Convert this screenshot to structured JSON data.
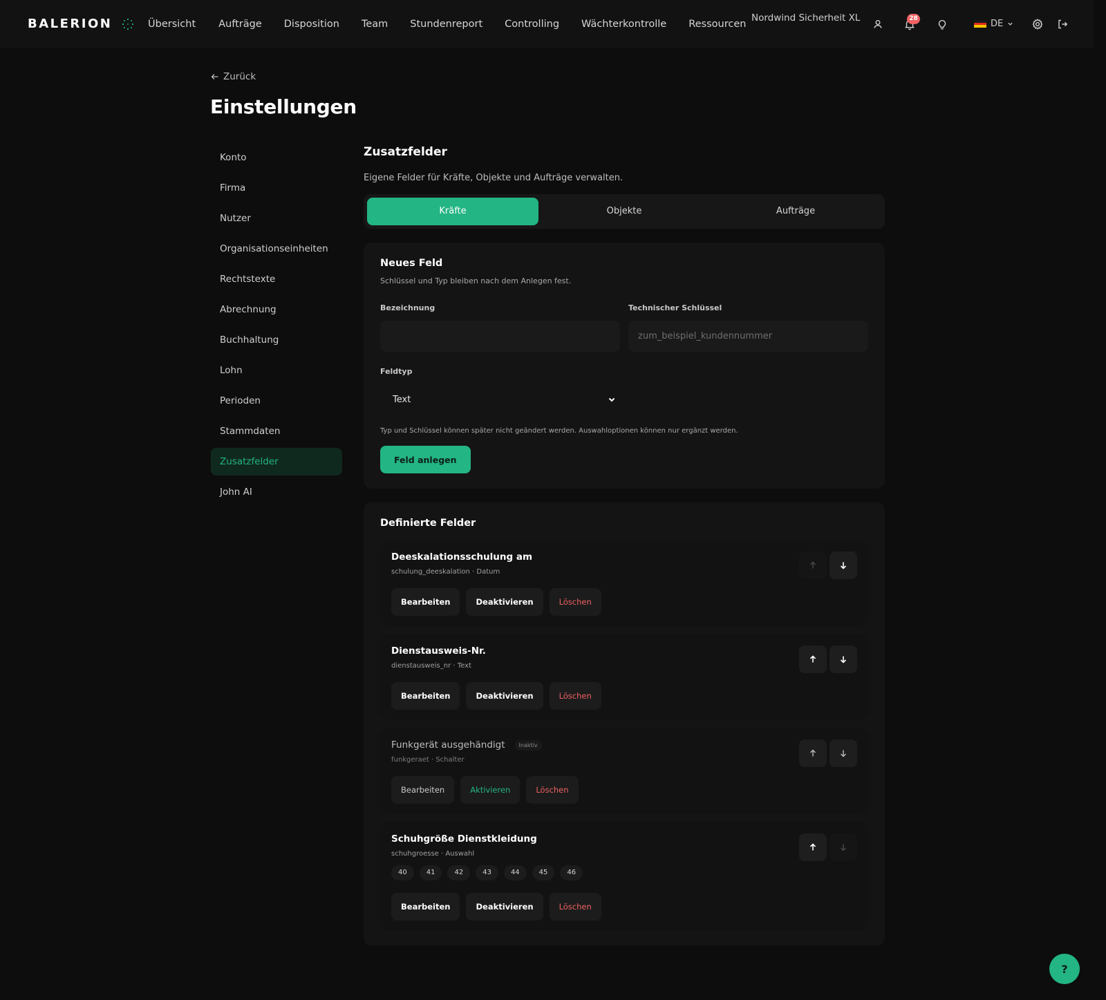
{
  "app": {
    "brand": "BALERION"
  },
  "nav": {
    "items": [
      "Übersicht",
      "Aufträge",
      "Disposition",
      "Team",
      "Stundenreport",
      "Controlling",
      "Wächterkontrolle",
      "Ressourcen"
    ]
  },
  "topbar": {
    "company": "Nordwind Sicherheit XL",
    "notifications_count": "28",
    "language": "DE"
  },
  "header": {
    "back_label": "Zurück",
    "title": "Einstellungen"
  },
  "sidebar": {
    "items": [
      {
        "label": "Konto"
      },
      {
        "label": "Firma"
      },
      {
        "label": "Nutzer"
      },
      {
        "label": "Organisationseinheiten"
      },
      {
        "label": "Rechtstexte"
      },
      {
        "label": "Abrechnung"
      },
      {
        "label": "Buchhaltung"
      },
      {
        "label": "Lohn"
      },
      {
        "label": "Perioden"
      },
      {
        "label": "Stammdaten"
      },
      {
        "label": "Zusatzfelder",
        "active": true
      },
      {
        "label": "John AI"
      }
    ]
  },
  "main": {
    "title": "Zusatzfelder",
    "subtitle": "Eigene Felder für Kräfte, Objekte und Aufträge verwalten.",
    "tabs": [
      {
        "label": "Kräfte",
        "active": true
      },
      {
        "label": "Objekte"
      },
      {
        "label": "Aufträge"
      }
    ]
  },
  "new_field": {
    "title": "Neues Feld",
    "subtitle": "Schlüssel und Typ bleiben nach dem Anlegen fest.",
    "label_label": "Bezeichnung",
    "label_value": "",
    "key_label": "Technischer Schlüssel",
    "key_placeholder": "zum_beispiel_kundennummer",
    "type_label": "Feldtyp",
    "type_value": "Text",
    "hint": "Typ und Schlüssel können später nicht geändert werden. Auswahloptionen können nur ergänzt werden.",
    "submit_label": "Feld anlegen"
  },
  "defined": {
    "title": "Definierte Felder",
    "actions": {
      "edit": "Bearbeiten",
      "deactivate": "Deaktivieren",
      "activate": "Aktivieren",
      "delete": "Löschen"
    },
    "inactive_tag": "Inaktiv",
    "fields": [
      {
        "name": "Deeskalationsschulung am",
        "meta": "schulung_deeskalation · Datum"
      },
      {
        "name": "Dienstausweis-Nr.",
        "meta": "dienstausweis_nr · Text"
      },
      {
        "name": "Funkgerät ausgehändigt",
        "meta": "funkgeraet · Schalter",
        "inactive": true
      },
      {
        "name": "Schuhgröße Dienstkleidung",
        "meta": "schuhgroesse · Auswahl",
        "options": [
          "40",
          "41",
          "42",
          "43",
          "44",
          "45",
          "46"
        ]
      }
    ]
  },
  "help": {
    "label": "?"
  },
  "colors": {
    "accent": "#23b584",
    "danger": "#f06161",
    "background": "#0d0d0d"
  }
}
